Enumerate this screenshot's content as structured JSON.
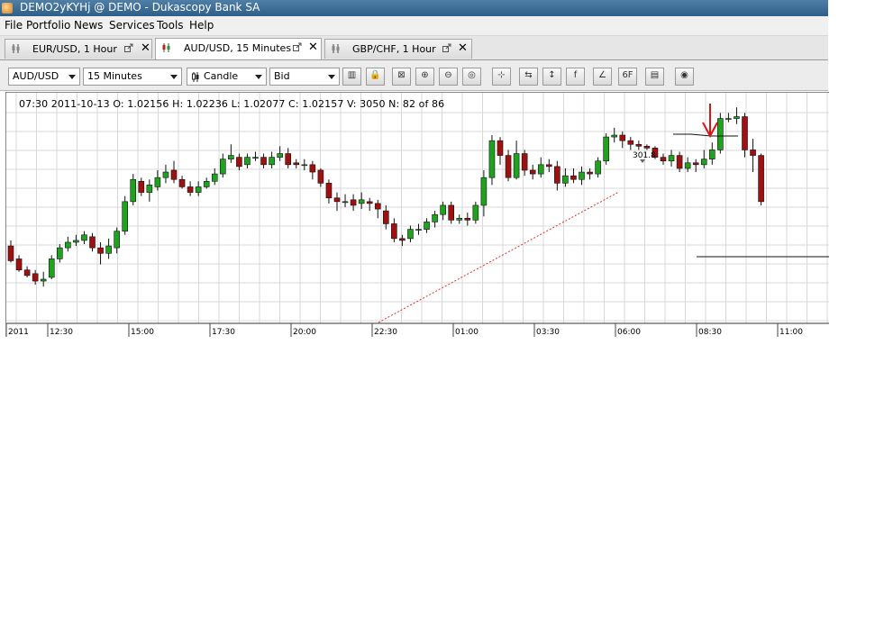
{
  "window": {
    "title": "DEMO2yKYHj @ DEMO - Dukascopy Bank SA"
  },
  "menu": [
    "File",
    "Portfolio",
    "News",
    "Services",
    "Tools",
    "Help"
  ],
  "tabs": [
    {
      "label": "EUR/USD,  1 Hour",
      "active": false
    },
    {
      "label": "AUD/USD,  15 Minutes",
      "active": true
    },
    {
      "label": "GBP/CHF,  1 Hour",
      "active": false
    }
  ],
  "toolbar": {
    "instrument": "AUD/USD",
    "period": "15 Minutes",
    "chart_type": "Candle",
    "side": "Bid",
    "icons": [
      "candle-type-icon",
      "lock-icon",
      "zoom-fit-icon",
      "zoom-in-icon",
      "zoom-out-icon",
      "zoom-custom-icon",
      "cursor-icon",
      "shift-icon",
      "vertical-range-icon",
      "indicator-icon",
      "drawing-icon",
      "fib-icon",
      "save-icon",
      "stop-icon"
    ]
  },
  "info_line": "07:30  2011-10-13   O: 1.02156   H: 1.02236   L: 1.02077   C: 1.02157   V: 3050   N: 82 of 86",
  "chart_data": {
    "type": "candlestick",
    "x_ticks": [
      "2011",
      "12:30",
      "15:00",
      "17:30",
      "20:00",
      "22:30",
      "01:00",
      "03:30",
      "06:00",
      "08:30",
      "11:00"
    ],
    "annotation": "301.8",
    "colors": {
      "up": "#1fa31f",
      "down": "#a01010",
      "grid": "#d8d8d8",
      "trendline": "#e03030",
      "arrow": "#d81414"
    },
    "candles": [
      [
        0.38,
        0.3,
        0.41,
        0.29
      ],
      [
        0.31,
        0.25,
        0.33,
        0.24
      ],
      [
        0.25,
        0.22,
        0.27,
        0.21
      ],
      [
        0.23,
        0.19,
        0.25,
        0.17
      ],
      [
        0.19,
        0.2,
        0.24,
        0.16
      ],
      [
        0.21,
        0.31,
        0.33,
        0.2
      ],
      [
        0.31,
        0.37,
        0.39,
        0.29
      ],
      [
        0.37,
        0.4,
        0.43,
        0.35
      ],
      [
        0.4,
        0.41,
        0.44,
        0.38
      ],
      [
        0.41,
        0.44,
        0.46,
        0.39
      ],
      [
        0.43,
        0.37,
        0.45,
        0.35
      ],
      [
        0.37,
        0.34,
        0.4,
        0.28
      ],
      [
        0.34,
        0.38,
        0.42,
        0.31
      ],
      [
        0.37,
        0.46,
        0.48,
        0.34
      ],
      [
        0.46,
        0.62,
        0.65,
        0.44
      ],
      [
        0.62,
        0.74,
        0.77,
        0.6
      ],
      [
        0.73,
        0.67,
        0.75,
        0.65
      ],
      [
        0.67,
        0.71,
        0.74,
        0.62
      ],
      [
        0.7,
        0.75,
        0.79,
        0.68
      ],
      [
        0.75,
        0.78,
        0.82,
        0.72
      ],
      [
        0.79,
        0.74,
        0.84,
        0.72
      ],
      [
        0.74,
        0.7,
        0.76,
        0.69
      ],
      [
        0.7,
        0.67,
        0.73,
        0.65
      ],
      [
        0.67,
        0.7,
        0.73,
        0.65
      ],
      [
        0.7,
        0.73,
        0.75,
        0.69
      ],
      [
        0.73,
        0.77,
        0.8,
        0.71
      ],
      [
        0.77,
        0.85,
        0.88,
        0.75
      ],
      [
        0.85,
        0.87,
        0.93,
        0.83
      ],
      [
        0.86,
        0.81,
        0.88,
        0.79
      ],
      [
        0.82,
        0.86,
        0.88,
        0.8
      ],
      [
        0.86,
        0.86,
        0.89,
        0.84
      ],
      [
        0.86,
        0.82,
        0.88,
        0.8
      ],
      [
        0.82,
        0.86,
        0.89,
        0.8
      ],
      [
        0.86,
        0.88,
        0.92,
        0.84
      ],
      [
        0.88,
        0.82,
        0.91,
        0.8
      ],
      [
        0.83,
        0.82,
        0.85,
        0.8
      ],
      [
        0.82,
        0.82,
        0.85,
        0.79
      ],
      [
        0.82,
        0.78,
        0.84,
        0.74
      ],
      [
        0.79,
        0.72,
        0.8,
        0.7
      ],
      [
        0.72,
        0.64,
        0.74,
        0.61
      ],
      [
        0.64,
        0.62,
        0.67,
        0.57
      ],
      [
        0.62,
        0.62,
        0.66,
        0.59
      ],
      [
        0.63,
        0.6,
        0.66,
        0.57
      ],
      [
        0.61,
        0.63,
        0.67,
        0.58
      ],
      [
        0.62,
        0.61,
        0.64,
        0.57
      ],
      [
        0.61,
        0.58,
        0.63,
        0.53
      ],
      [
        0.57,
        0.5,
        0.6,
        0.47
      ],
      [
        0.5,
        0.42,
        0.53,
        0.4
      ],
      [
        0.42,
        0.41,
        0.44,
        0.38
      ],
      [
        0.42,
        0.47,
        0.49,
        0.4
      ],
      [
        0.47,
        0.47,
        0.5,
        0.44
      ],
      [
        0.47,
        0.51,
        0.53,
        0.45
      ],
      [
        0.51,
        0.55,
        0.57,
        0.48
      ],
      [
        0.55,
        0.6,
        0.62,
        0.52
      ],
      [
        0.6,
        0.52,
        0.62,
        0.5
      ],
      [
        0.52,
        0.53,
        0.55,
        0.5
      ],
      [
        0.53,
        0.52,
        0.56,
        0.49
      ],
      [
        0.52,
        0.6,
        0.62,
        0.5
      ],
      [
        0.6,
        0.75,
        0.79,
        0.54
      ],
      [
        0.75,
        0.95,
        0.98,
        0.71
      ],
      [
        0.95,
        0.87,
        0.97,
        0.82
      ],
      [
        0.87,
        0.75,
        0.9,
        0.73
      ],
      [
        0.75,
        0.88,
        0.95,
        0.74
      ],
      [
        0.88,
        0.79,
        0.9,
        0.76
      ],
      [
        0.79,
        0.77,
        0.82,
        0.74
      ],
      [
        0.77,
        0.82,
        0.86,
        0.75
      ],
      [
        0.82,
        0.81,
        0.85,
        0.78
      ],
      [
        0.81,
        0.72,
        0.84,
        0.68
      ],
      [
        0.72,
        0.76,
        0.8,
        0.7
      ],
      [
        0.76,
        0.74,
        0.8,
        0.72
      ],
      [
        0.74,
        0.78,
        0.81,
        0.71
      ],
      [
        0.78,
        0.77,
        0.8,
        0.74
      ],
      [
        0.77,
        0.84,
        0.86,
        0.75
      ],
      [
        0.84,
        0.97,
        0.99,
        0.82
      ],
      [
        0.97,
        0.98,
        1.02,
        0.94
      ],
      [
        0.98,
        0.95,
        1.0,
        0.91
      ],
      [
        0.95,
        0.93,
        0.97,
        0.9
      ],
      [
        0.93,
        0.92,
        0.95,
        0.9
      ],
      [
        0.92,
        0.91,
        0.93,
        0.9
      ],
      [
        0.91,
        0.86,
        0.92,
        0.85
      ],
      [
        0.86,
        0.84,
        0.88,
        0.82
      ],
      [
        0.84,
        0.87,
        0.9,
        0.81
      ],
      [
        0.87,
        0.8,
        0.89,
        0.78
      ],
      [
        0.8,
        0.83,
        0.86,
        0.78
      ],
      [
        0.83,
        0.82,
        0.85,
        0.78
      ],
      [
        0.82,
        0.85,
        0.9,
        0.8
      ],
      [
        0.85,
        0.9,
        0.94,
        0.82
      ],
      [
        0.9,
        1.07,
        1.1,
        0.88
      ],
      [
        1.07,
        1.07,
        1.1,
        1.05
      ],
      [
        1.07,
        1.08,
        1.13,
        1.04
      ],
      [
        1.08,
        0.9,
        1.1,
        0.86
      ],
      [
        0.9,
        0.87,
        0.96,
        0.78
      ],
      [
        0.87,
        0.62,
        0.88,
        0.6
      ]
    ],
    "y_range": [
      0.0,
      1.18
    ]
  }
}
